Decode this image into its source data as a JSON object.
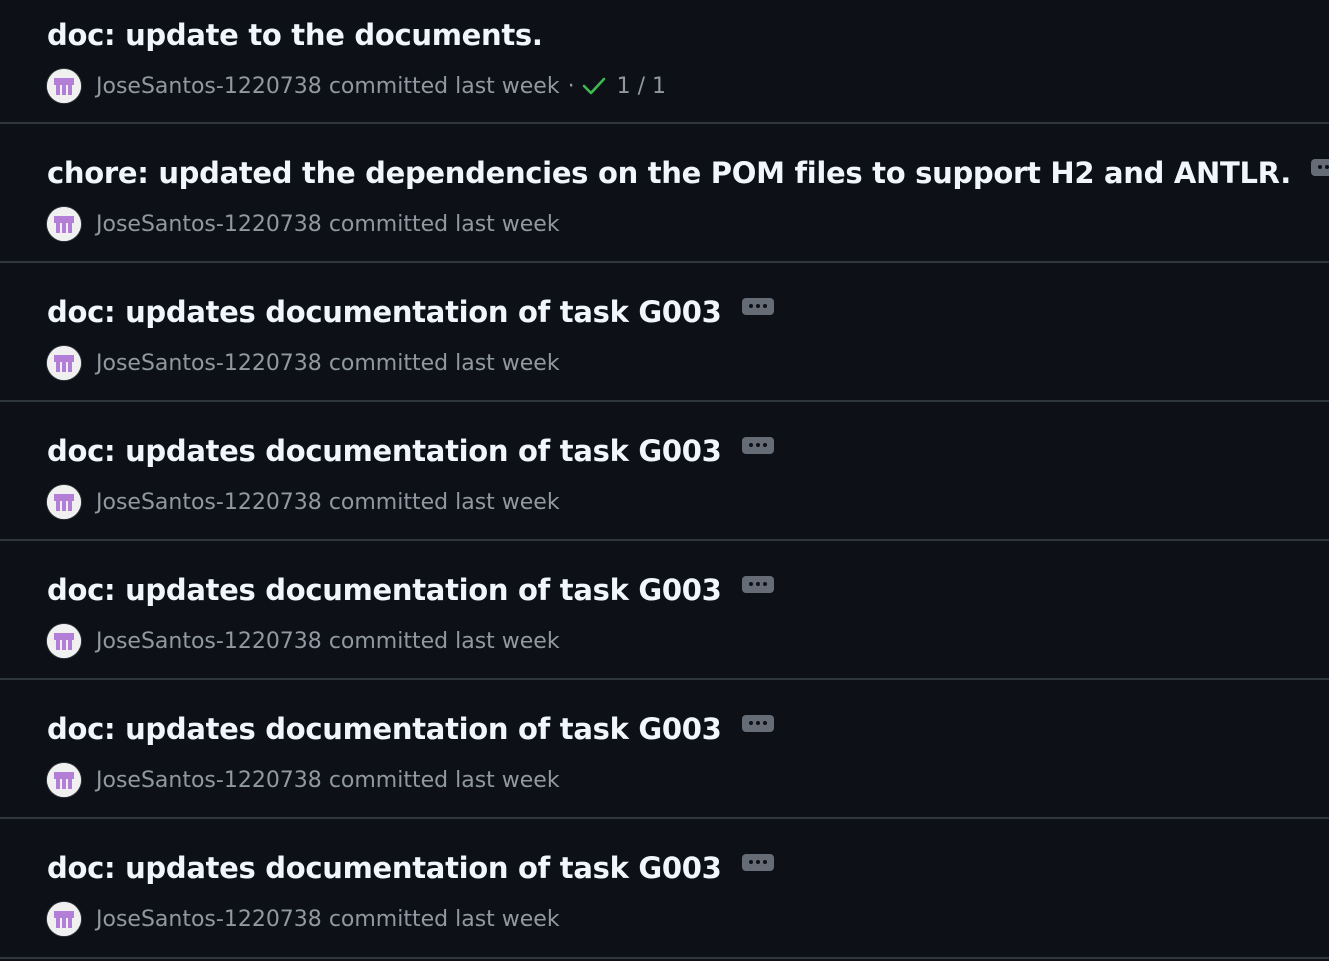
{
  "commits": [
    {
      "title": "doc: update to the documents.",
      "author": "JoseSantos-1220738",
      "verb": "committed",
      "when": "last week",
      "separator": "·",
      "checks": "1 / 1",
      "has_ellipsis": false,
      "has_checks": true
    },
    {
      "title": "chore: updated the dependencies on the POM files to support H2 and ANTLR.",
      "author": "JoseSantos-1220738",
      "verb": "committed",
      "when": "last week",
      "has_ellipsis": true,
      "has_checks": false
    },
    {
      "title": "doc: updates documentation of task G003",
      "author": "JoseSantos-1220738",
      "verb": "committed",
      "when": "last week",
      "has_ellipsis": true,
      "has_checks": false
    },
    {
      "title": "doc: updates documentation of task G003",
      "author": "JoseSantos-1220738",
      "verb": "committed",
      "when": "last week",
      "has_ellipsis": true,
      "has_checks": false
    },
    {
      "title": "doc: updates documentation of task G003",
      "author": "JoseSantos-1220738",
      "verb": "committed",
      "when": "last week",
      "has_ellipsis": true,
      "has_checks": false
    },
    {
      "title": "doc: updates documentation of task G003",
      "author": "JoseSantos-1220738",
      "verb": "committed",
      "when": "last week",
      "has_ellipsis": true,
      "has_checks": false
    },
    {
      "title": "doc: updates documentation of task G003",
      "author": "JoseSantos-1220738",
      "verb": "committed",
      "when": "last week",
      "has_ellipsis": true,
      "has_checks": false
    }
  ],
  "icons": {
    "avatar": "identicon-avatar",
    "check": "check-icon",
    "ellipsis": "ellipsis-icon"
  },
  "colors": {
    "background": "#0d1117",
    "title": "#f0f6fc",
    "meta": "#9198a1",
    "divider": "#30363d",
    "check": "#3fb950",
    "avatar_purple": "#b27ed6"
  }
}
